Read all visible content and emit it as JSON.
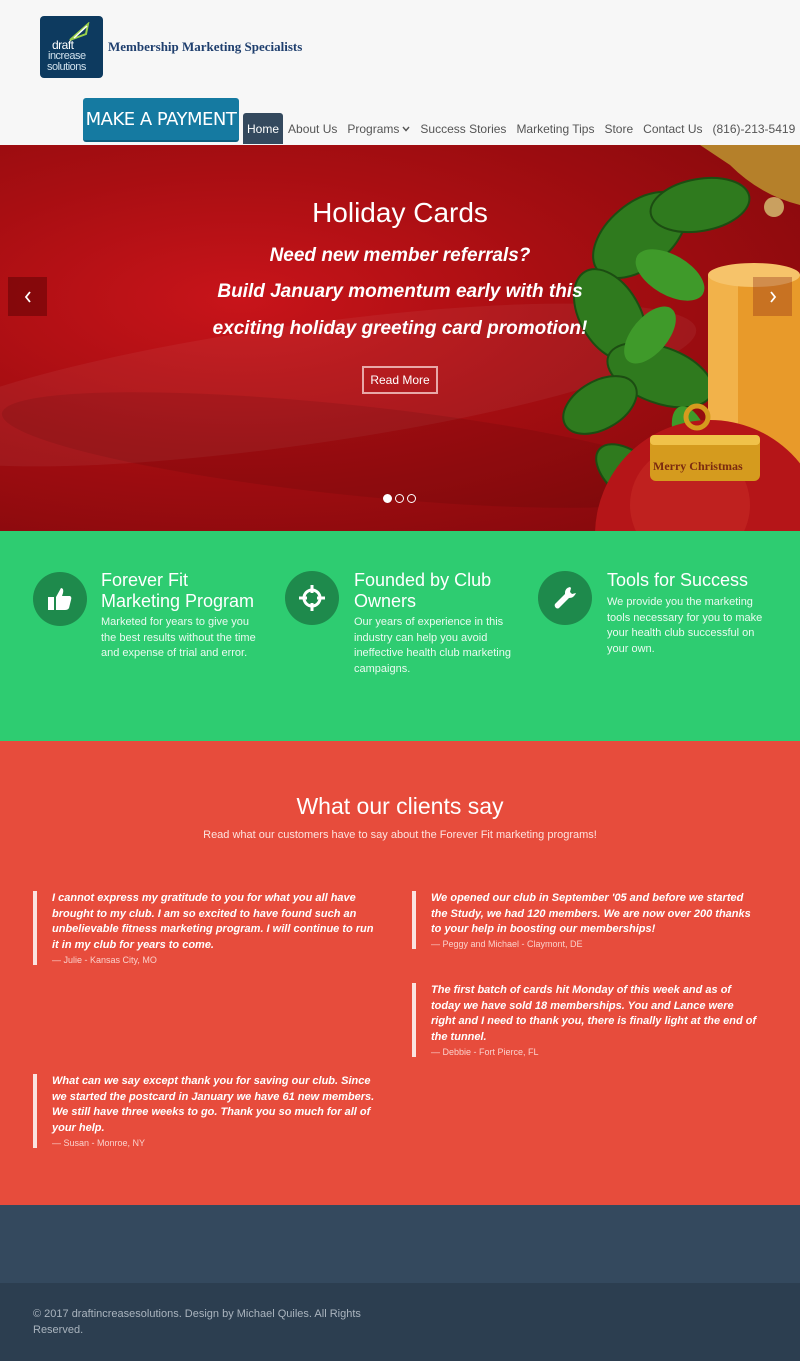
{
  "header": {
    "logo": {
      "line1": "draft",
      "line2": "increase",
      "line3": "solutions"
    },
    "tagline": "Membership Marketing Specialists",
    "pay_button": "MAKE A PAYMENT"
  },
  "nav": {
    "items": [
      {
        "label": "Home",
        "active": true
      },
      {
        "label": "About Us"
      },
      {
        "label": "Programs",
        "has_dropdown": true
      },
      {
        "label": "Success Stories"
      },
      {
        "label": "Marketing Tips"
      },
      {
        "label": "Store"
      },
      {
        "label": "Contact Us"
      },
      {
        "label": "(816)-213-5419"
      }
    ],
    "dropdown_icon": "chevron-down-icon"
  },
  "hero": {
    "title": "Holiday Cards",
    "line1": "Need new member referrals?",
    "line2": "Build January momentum early with this",
    "line3": "exciting holiday greeting card promotion!",
    "button": "Read More",
    "ornament_text": "Merry Christmas",
    "prev_icon": "chevron-left-icon",
    "next_icon": "chevron-right-icon",
    "active_slide": 1,
    "slide_count": 3
  },
  "features": [
    {
      "icon": "thumbs-up-icon",
      "title": "Forever Fit Marketing Program",
      "title_l1": "Forever Fit",
      "title_l2": "Marketing Program",
      "text": "Marketed for years to give you the best results without the time and expense of trial and error."
    },
    {
      "icon": "crosshair-icon",
      "title": "Founded by Club Owners",
      "title_l1": "Founded by Club",
      "title_l2": "Owners",
      "text": "Our years of experience in this industry can help you avoid ineffective health club marketing campaigns."
    },
    {
      "icon": "wrench-icon",
      "title": "Tools for Success",
      "title_l1": "Tools for Success",
      "title_l2": "",
      "text": "We provide you the marketing tools necessary for you to make your health club successful on your own."
    }
  ],
  "testimonials": {
    "title": "What our clients say",
    "subtitle": "Read what our customers have to say about the Forever Fit  marketing programs!",
    "items": [
      {
        "text": "I cannot express my gratitude to you for what you all have brought to my club. I am so excited to have found such an unbelievable fitness marketing program. I will continue to run it in my club for years to come.",
        "author": "— Julie - Kansas City, MO"
      },
      {
        "text": "We opened our club in September '05 and before we started the Study, we had 120 members. We are now over 200 thanks to your help in boosting our memberships!",
        "author": "— Peggy and Michael - Claymont, DE"
      },
      {
        "text": "The first batch of cards hit Monday of this week and as of today we have sold 18 memberships.  You and Lance were right and I need to thank you, there is finally light at the end of the tunnel.",
        "author": "— Debbie - Fort Pierce, FL"
      },
      {
        "text": "What can we say except thank you for saving our club.  Since we started the postcard in January we have 61 new members.  We still have three weeks to go.  Thank you so much for all of your help.",
        "author": "— Susan - Monroe, NY"
      }
    ]
  },
  "footer": {
    "copyright": "© 2017 draftincreasesolutions. Design by Michael Quiles. All Rights Reserved."
  },
  "colors": {
    "pay_button": "#157aa1",
    "nav_active": "#34495e",
    "hero_red": "#b01015",
    "features_green": "#2ecc71",
    "feature_icon_bg": "#1e8a4c",
    "testimonials_red": "#e74c3c",
    "footer_top": "#34495e",
    "footer_bottom": "#2c3e50"
  }
}
